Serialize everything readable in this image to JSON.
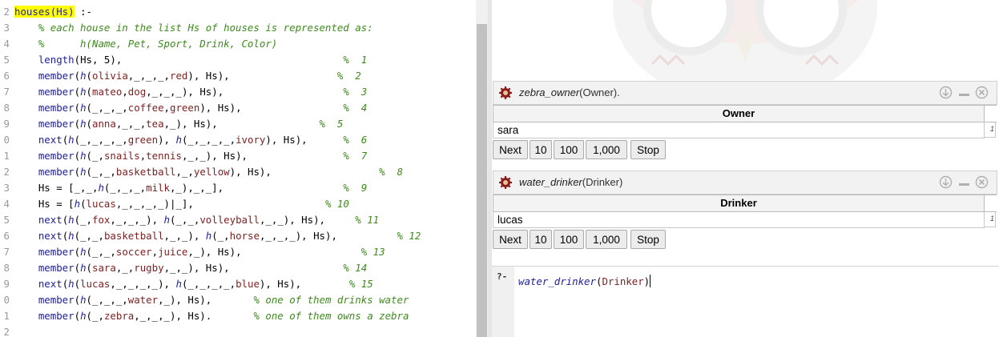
{
  "editor": {
    "lines": [
      {
        "num": "2",
        "code": "houses(Hs) :-"
      },
      {
        "num": "3",
        "code": "    % each house in the list Hs of houses is represented as:"
      },
      {
        "num": "4",
        "code": "    %      h(Name, Pet, Sport, Drink, Color)"
      },
      {
        "num": "5",
        "code": "    length(Hs, 5),                                     %  1"
      },
      {
        "num": "6",
        "code": "    member(h(olivia,_,_,_,red), Hs),                  %  2"
      },
      {
        "num": "7",
        "code": "    member(h(mateo,dog,_,_,_), Hs),                    %  3"
      },
      {
        "num": "8",
        "code": "    member(h(_,_,_,coffee,green), Hs),                 %  4"
      },
      {
        "num": "9",
        "code": "    member(h(anna,_,_,tea,_), Hs),                 %  5"
      },
      {
        "num": "0",
        "code": "    next(h(_,_,_,_,green), h(_,_,_,_,ivory), Hs),      %  6"
      },
      {
        "num": "1",
        "code": "    member(h(_,snails,tennis,_,_), Hs),                %  7"
      },
      {
        "num": "2",
        "code": "    member(h(_,_,basketball,_,yellow), Hs),                  %  8"
      },
      {
        "num": "3",
        "code": "    Hs = [_,_,h(_,_,_,milk,_),_,_],                    %  9"
      },
      {
        "num": "4",
        "code": "    Hs = [h(lucas,_,_,_,_)|_],                      % 10"
      },
      {
        "num": "5",
        "code": "    next(h(_,fox,_,_,_), h(_,_,volleyball,_,_), Hs),     % 11"
      },
      {
        "num": "6",
        "code": "    next(h(_,_,basketball,_,_), h(_,horse,_,_,_), Hs),          % 12"
      },
      {
        "num": "7",
        "code": "    member(h(_,_,soccer,juice,_), Hs),                    % 13"
      },
      {
        "num": "8",
        "code": "    member(h(sara,_,rugby,_,_), Hs),                   % 14"
      },
      {
        "num": "9",
        "code": "    next(h(lucas,_,_,_,_), h(_,_,_,_,blue), Hs),        % 15"
      },
      {
        "num": "0",
        "code": "    member(h(_,_,_,water,_), Hs),       % one of them drinks water"
      },
      {
        "num": "1",
        "code": "    member(h(_,zebra,_,_,_), Hs).       % one of them owns a zebra"
      },
      {
        "num": "2",
        "code": ""
      }
    ]
  },
  "queries": [
    {
      "icon": "gear-icon",
      "functor": "zebra_owner",
      "args": "(Owner).",
      "column": "Owner",
      "rows": [
        {
          "value": "sara",
          "index": "1"
        }
      ],
      "buttons": [
        "Next",
        "10",
        "100",
        "1,000",
        "Stop"
      ]
    },
    {
      "icon": "gear-icon",
      "functor": "water_drinker",
      "args": "(Drinker)",
      "column": "Drinker",
      "rows": [
        {
          "value": "lucas",
          "index": "1"
        }
      ],
      "buttons": [
        "Next",
        "10",
        "100",
        "1,000",
        "Stop"
      ]
    }
  ],
  "query_editor": {
    "prompt": "?-",
    "functor": "water_drinker",
    "args_open": "(",
    "arg": "Drinker",
    "args_close": ")"
  },
  "colors": {
    "comment": "#3e8a1d",
    "functor": "#1d1d9c",
    "atom": "#7a1f1f",
    "highlight": "#ffff00"
  }
}
